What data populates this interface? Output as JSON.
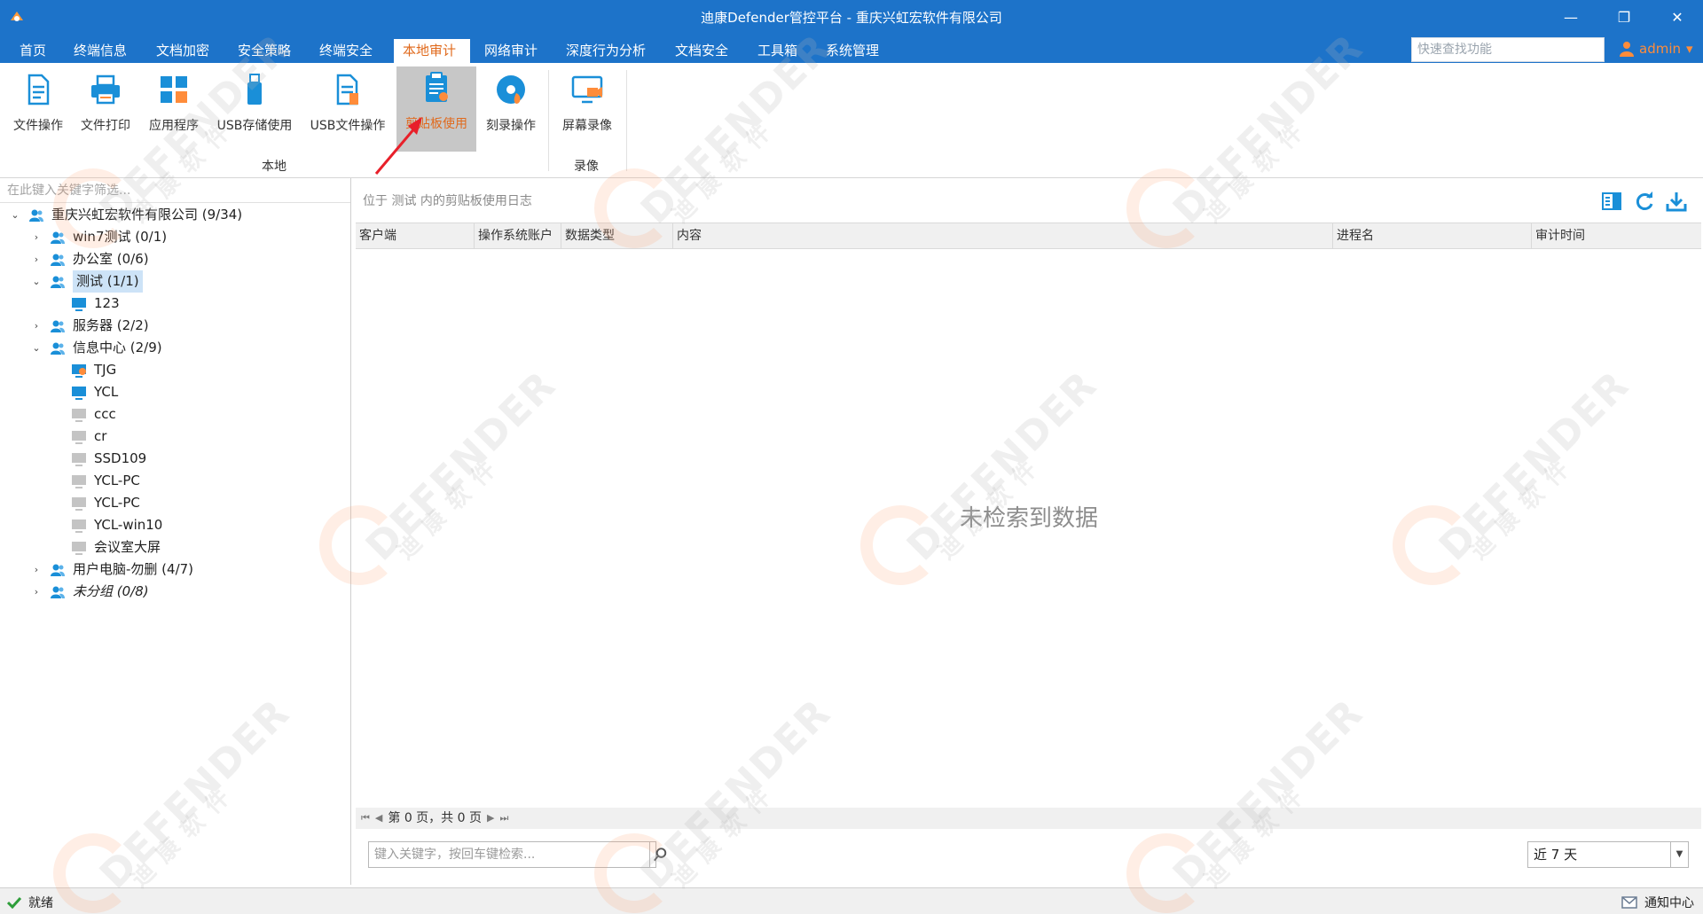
{
  "window": {
    "title": "迪康Defender管控平台 - 重庆兴虹宏软件有限公司",
    "minimize_glyph": "—",
    "restore_glyph": "❐",
    "close_glyph": "✕"
  },
  "menu": {
    "items": [
      "首页",
      "终端信息",
      "文档加密",
      "安全策略",
      "终端安全",
      "本地审计",
      "网络审计",
      "深度行为分析",
      "文档安全",
      "工具箱",
      "系统管理"
    ],
    "active": "本地审计"
  },
  "quick_search": {
    "placeholder": "快速查找功能"
  },
  "user": {
    "name": "admin",
    "caret": "▾"
  },
  "ribbon": {
    "buttons": [
      {
        "label": "文件操作",
        "icon": "file-operation-icon"
      },
      {
        "label": "文件打印",
        "icon": "printer-icon"
      },
      {
        "label": "应用程序",
        "icon": "apps-icon"
      },
      {
        "label": "USB存储使用",
        "icon": "usb-drive-icon"
      },
      {
        "label": "USB文件操作",
        "icon": "usb-file-icon"
      },
      {
        "label": "剪贴板使用",
        "icon": "clipboard-icon"
      },
      {
        "label": "刻录操作",
        "icon": "disc-burn-icon"
      },
      {
        "label": "屏幕录像",
        "icon": "screen-record-icon"
      }
    ],
    "active": "剪贴板使用",
    "groups": [
      "本地",
      "录像"
    ]
  },
  "left": {
    "filter_placeholder": "在此键入关键字筛选...",
    "tree": [
      {
        "label": "重庆兴虹宏软件有限公司 (9/34)",
        "level": 0,
        "expand": "open",
        "icon": "group"
      },
      {
        "label": "win7测试 (0/1)",
        "level": 1,
        "expand": "closed",
        "icon": "group"
      },
      {
        "label": "办公室 (0/6)",
        "level": 1,
        "expand": "closed",
        "icon": "group"
      },
      {
        "label": "测试 (1/1)",
        "level": 1,
        "expand": "open",
        "icon": "group",
        "selected": true
      },
      {
        "label": "123",
        "level": 2,
        "expand": "none",
        "icon": "pc-online"
      },
      {
        "label": "服务器 (2/2)",
        "level": 1,
        "expand": "closed",
        "icon": "group"
      },
      {
        "label": "信息中心 (2/9)",
        "level": 1,
        "expand": "open",
        "icon": "group"
      },
      {
        "label": "TJG",
        "level": 2,
        "expand": "none",
        "icon": "pc-alert"
      },
      {
        "label": "YCL",
        "level": 2,
        "expand": "none",
        "icon": "pc-online"
      },
      {
        "label": "ccc",
        "level": 2,
        "expand": "none",
        "icon": "pc-offline"
      },
      {
        "label": "cr",
        "level": 2,
        "expand": "none",
        "icon": "pc-offline"
      },
      {
        "label": "SSD109",
        "level": 2,
        "expand": "none",
        "icon": "pc-offline"
      },
      {
        "label": "YCL-PC",
        "level": 2,
        "expand": "none",
        "icon": "pc-offline"
      },
      {
        "label": "YCL-PC",
        "level": 2,
        "expand": "none",
        "icon": "pc-offline"
      },
      {
        "label": "YCL-win10",
        "level": 2,
        "expand": "none",
        "icon": "pc-offline"
      },
      {
        "label": "会议室大屏",
        "level": 2,
        "expand": "none",
        "icon": "pc-offline"
      },
      {
        "label": "用户电脑-勿删 (4/7)",
        "level": 1,
        "expand": "closed",
        "icon": "group"
      },
      {
        "label": "未分组 (0/8)",
        "level": 1,
        "expand": "closed",
        "icon": "group",
        "italic": true
      }
    ]
  },
  "right": {
    "breadcrumb": "位于 测试 内的剪贴板使用日志",
    "columns": [
      "客户端",
      "操作系统账户",
      "数据类型",
      "内容",
      "进程名",
      "审计时间"
    ],
    "empty_message": "未检索到数据",
    "pager": {
      "first": "⏮",
      "prev": "◀",
      "text": "第 0 页，共 0 页",
      "next": "▶",
      "last": "⏭"
    },
    "search_placeholder": "键入关键字，按回车键检索...",
    "range": "近 7 天"
  },
  "status": {
    "left": "就绪",
    "right": "通知中心"
  },
  "watermark": {
    "text": "DEFENDER",
    "sub": "迪 康 软 件"
  },
  "colors": {
    "accent": "#1d73c9",
    "active_text": "#e06a1d",
    "icon_blue": "#1a8fd8"
  }
}
